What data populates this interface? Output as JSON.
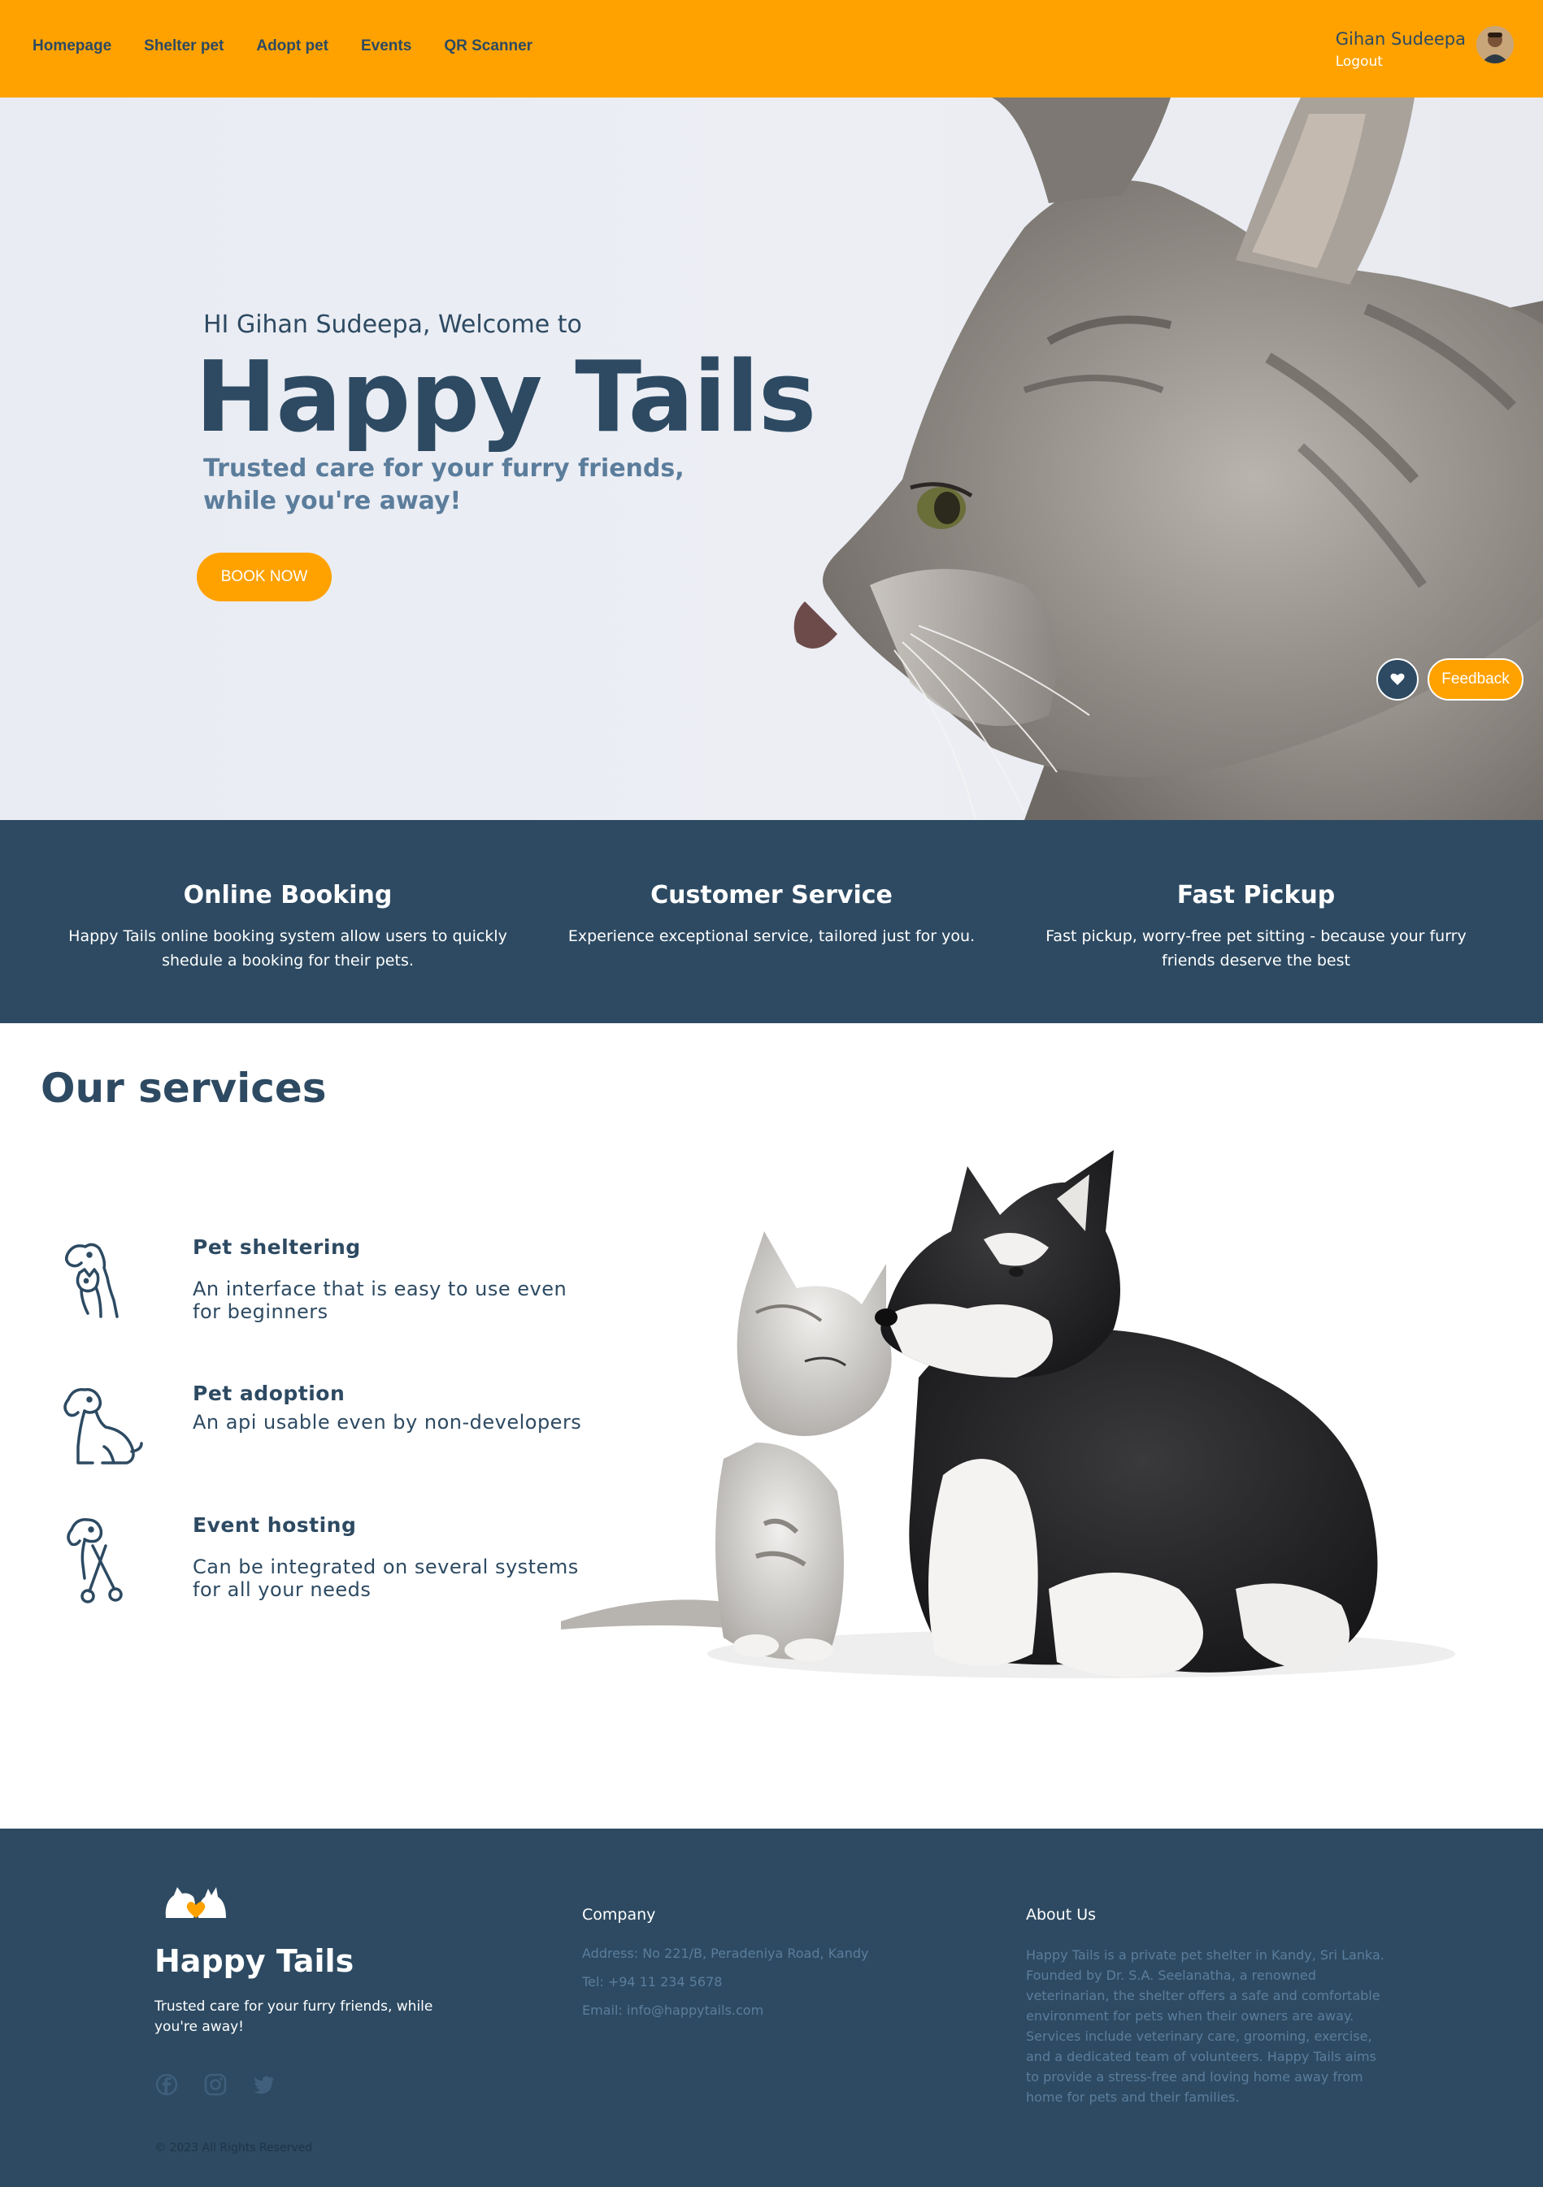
{
  "nav": {
    "links": [
      "Homepage",
      "Shelter pet",
      "Adopt pet",
      "Events",
      "QR Scanner"
    ],
    "user_name": "Gihan Sudeepa",
    "logout": "Logout"
  },
  "hero": {
    "greeting": "HI Gihan Sudeepa, Welcome to",
    "title": "Happy Tails",
    "subtitle": "Trusted care for your furry friends, while you're away!",
    "book_button": "BOOK NOW",
    "feedback_button": "Feedback"
  },
  "features": [
    {
      "title": "Online Booking",
      "text": "Happy Tails online booking system allow users to quickly shedule a booking for their pets."
    },
    {
      "title": "Customer Service",
      "text": "Experience exceptional service, tailored just for you."
    },
    {
      "title": "Fast Pickup",
      "text": "Fast pickup, worry-free pet sitting - because your furry friends deserve the best"
    }
  ],
  "services": {
    "title": "Our services",
    "items": [
      {
        "title": "Pet sheltering",
        "desc": "An interface that is easy to use even for beginners",
        "icon": "dog-cat-icon"
      },
      {
        "title": "Pet adoption",
        "desc": "An api usable even by non-developers",
        "icon": "sitting-dog-icon"
      },
      {
        "title": "Event hosting",
        "desc": "Can be integrated on several systems for all your needs",
        "icon": "dog-grooming-icon"
      }
    ]
  },
  "footer": {
    "brand": "Happy Tails",
    "tagline": "Trusted care for your furry friends, while you're away!",
    "company_title": "Company",
    "address": "Address: No 221/B, Peradeniya Road, Kandy",
    "tel": "Tel: +94 11 234 5678",
    "email": "Email: info@happytails.com",
    "about_title": "About Us",
    "about_text": "Happy Tails is a private pet shelter in Kandy, Sri Lanka. Founded by Dr. S.A. Seelanatha, a renowned veterinarian, the shelter offers a safe and comfortable environment for pets when their owners are away. Services include veterinary care, grooming, exercise, and a dedicated team of volunteers. Happy Tails aims to provide a stress-free and loving home away from home for pets and their families.",
    "copyright": "© 2023 All Rights Reserved",
    "social": [
      "facebook-icon",
      "instagram-icon",
      "twitter-icon"
    ]
  },
  "colors": {
    "accent": "#ffa200",
    "navy": "#2d4a62",
    "muted_blue": "#5b7d9c"
  }
}
